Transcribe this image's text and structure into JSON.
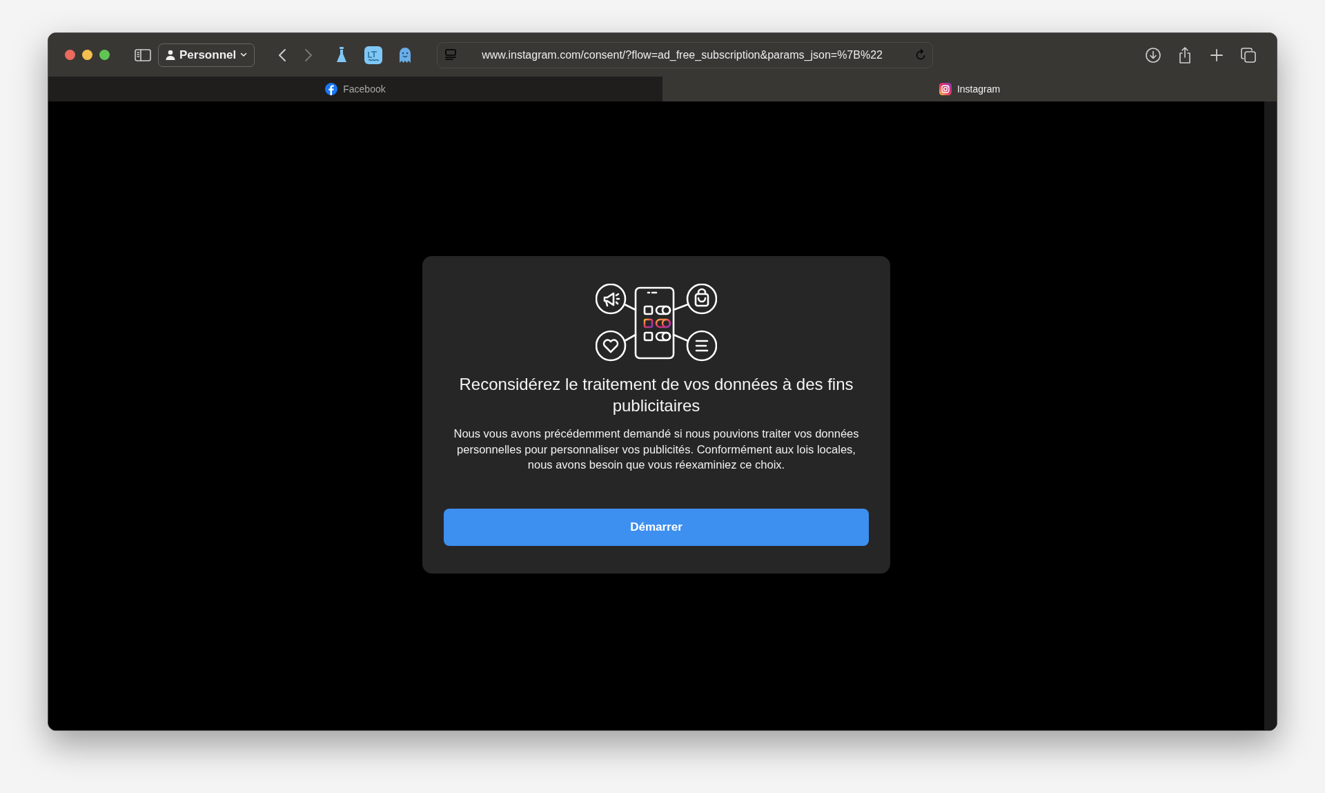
{
  "window": {
    "profile": "Personnel",
    "url": "www.instagram.com/consent/?flow=ad_free_subscription&params_json=%7B%22"
  },
  "tabs": [
    {
      "label": "Facebook",
      "selected": false,
      "kind": "facebook"
    },
    {
      "label": "Instagram",
      "selected": true,
      "kind": "instagram"
    }
  ],
  "dialog": {
    "title": "Reconsidérez le traitement de vos données à des fins publicitaires",
    "body": "Nous vous avons précédemment demandé si nous pouvions traiter vos données personnelles pour personnaliser vos publicités. Conformément aux lois locales, nous avons besoin que vous réexaminiez ce choix.",
    "button": "Démarrer"
  }
}
